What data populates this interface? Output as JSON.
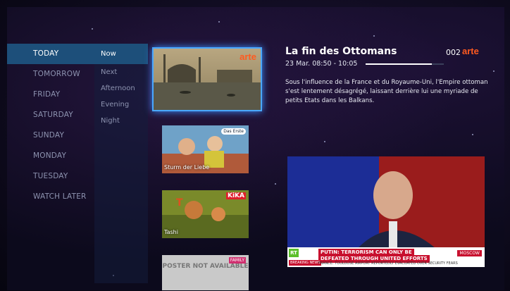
{
  "days": [
    "TODAY",
    "TOMORROW",
    "FRIDAY",
    "SATURDAY",
    "SUNDAY",
    "MONDAY",
    "TUESDAY",
    "WATCH LATER"
  ],
  "times": [
    "Now",
    "Next",
    "Afternoon",
    "Evening",
    "Night"
  ],
  "program": {
    "title": "La fin des Ottomans",
    "channel_number": "002",
    "channel_logo": "arte",
    "time": "23 Mar. 08:50 - 10:05",
    "progress": 0.85,
    "description": "Sous l'influence de la France et du Royaume-Uni, l'Empire ottoman s'est lentement désagrégé, laissant derrière lui une myriade de petits Etats dans les Balkans."
  },
  "thumbs": {
    "selected_logo": "arte",
    "t2_title": "Sturm der Liebe",
    "t2_logo": "Das Erste",
    "t3_title": "Tashi",
    "t3_logo": "KiKA",
    "t4_text": "POSTER NOT AVAILABLE",
    "t4_logo": "FAMILY"
  },
  "video": {
    "channel_logo": "RT",
    "headline_1": "PUTIN: TERRORISM CAN ONLY BE",
    "headline_2": "DEFEATED THROUGH UNITED EFFORTS",
    "location": "MOSCOW",
    "breaking_tag": "BREAKING NEWS",
    "ticker": "FRANCE: TOULOUSE AIRPORT REPORTEDLY EVACUATED OVER SECURITY FEARS"
  },
  "colors": {
    "accent": "#1d4f7a",
    "highlight": "#4aa8ff",
    "arte": "#ff5a1f"
  }
}
